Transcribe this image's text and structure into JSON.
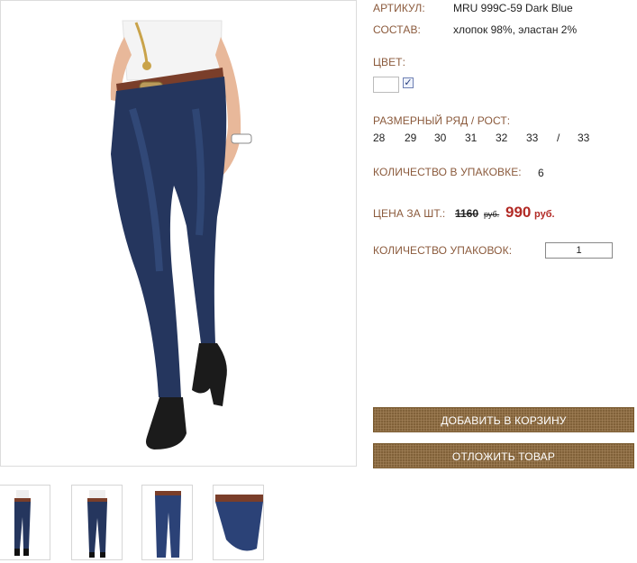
{
  "product": {
    "article_label": "АРТИКУЛ:",
    "article_value": "MRU 999C-59 Dark Blue",
    "composition_label": "СОСТАВ:",
    "composition_value": "хлопок 98%, эластан 2%",
    "color_label": "ЦВЕТ:",
    "color_checked": "✓",
    "sizes_label": "РАЗМЕРНЫЙ РЯД / РОСТ:",
    "sizes": [
      "28",
      "29",
      "30",
      "31",
      "32",
      "33",
      "/",
      "33"
    ],
    "pack_qty_label": "КОЛИЧЕСТВО В УПАКОВКЕ:",
    "pack_qty_value": "6",
    "price_label": "ЦЕНА ЗА ШТ.:",
    "price_old": "1160",
    "price_old_currency": "руб.",
    "price_new": "990",
    "price_new_currency": "руб.",
    "packs_label": "КОЛИЧЕСТВО УПАКОВОК:",
    "packs_value": "1"
  },
  "buttons": {
    "add_to_cart": "ДОБАВИТЬ В КОРЗИНУ",
    "postpone": "ОТЛОЖИТЬ ТОВАР"
  },
  "thumbnails": [
    "jeans-front-thumb",
    "jeans-back-thumb",
    "jeans-flat-thumb",
    "jeans-detail-thumb"
  ],
  "colors": {
    "label": "#8b5a3c",
    "price": "#b22a25",
    "button": "#8d6a3c",
    "denim": "#25365e"
  }
}
